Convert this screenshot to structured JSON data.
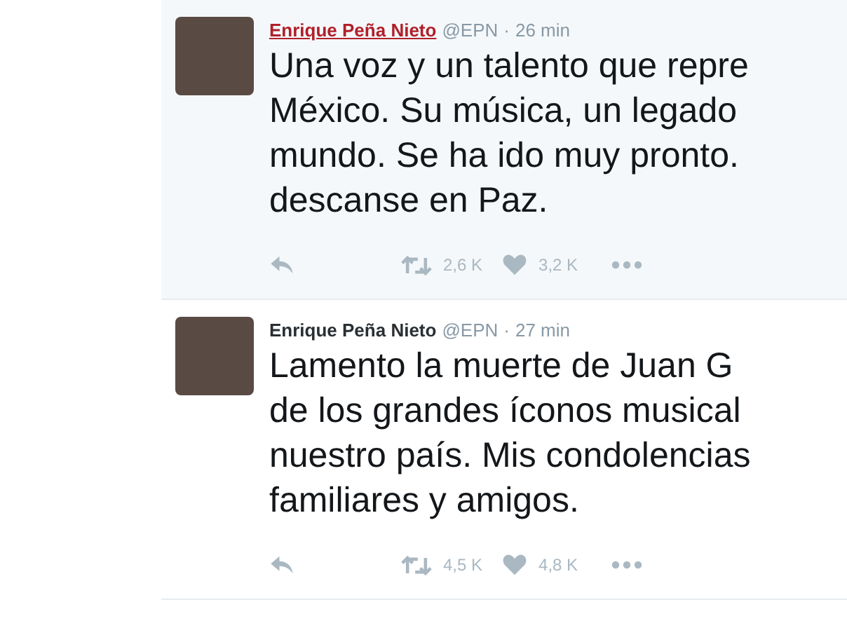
{
  "tweets": [
    {
      "author": "Enrique Peña Nieto",
      "handle": "@EPN",
      "separator": "·",
      "time": "26 min",
      "hovered": true,
      "lines": [
        "Una voz y un talento que repre",
        "México. Su música, un legado",
        "mundo. Se ha ido muy pronto.",
        "descanse en Paz."
      ],
      "retweets": "2,6 K",
      "likes": "3,2 K"
    },
    {
      "author": "Enrique Peña Nieto",
      "handle": "@EPN",
      "separator": "·",
      "time": "27 min",
      "hovered": false,
      "lines": [
        "Lamento la muerte de Juan G",
        "de los grandes íconos musical",
        "nuestro país. Mis condolencias",
        "familiares y amigos."
      ],
      "retweets": "4,5 K",
      "likes": "4,8 K"
    }
  ]
}
